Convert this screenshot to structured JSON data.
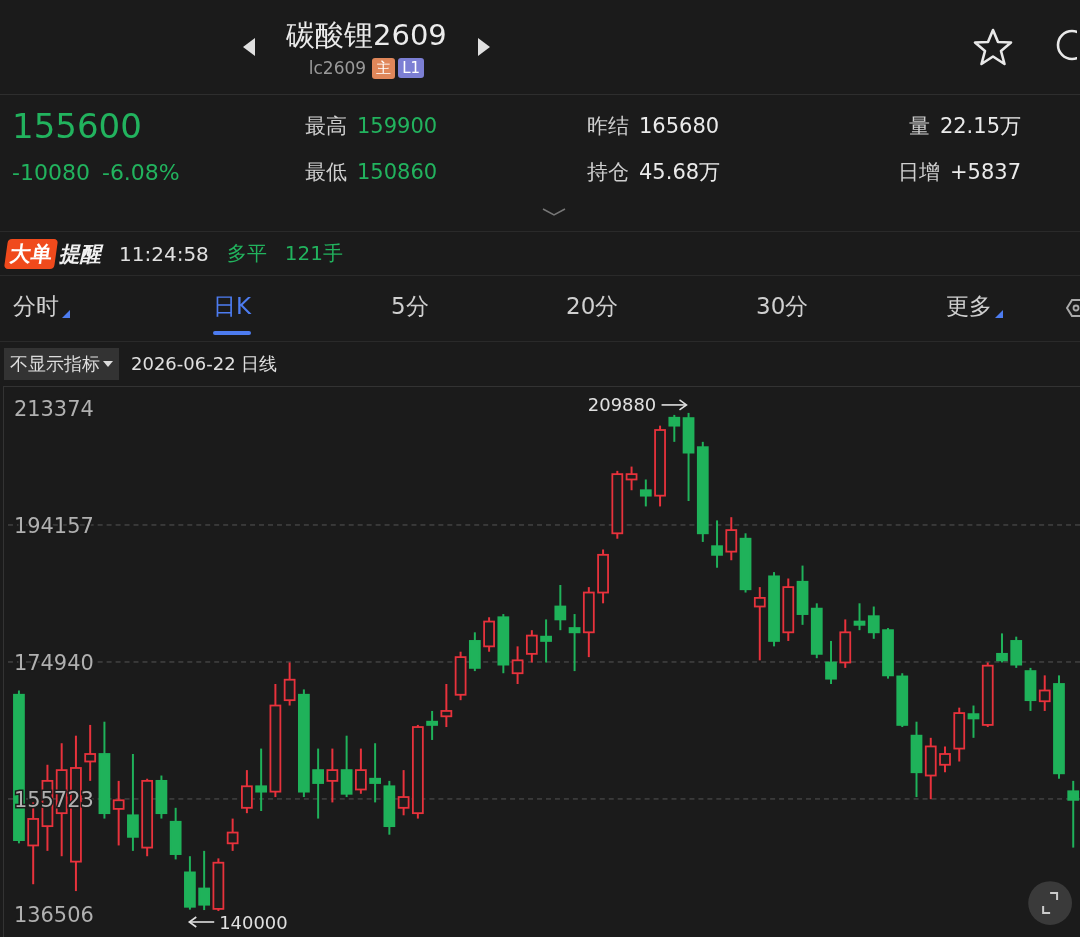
{
  "header": {
    "title": "碳酸锂2609",
    "code": "lc2609",
    "badges": [
      {
        "label": "主",
        "color": "#e0875a"
      },
      {
        "label": "L1",
        "color": "#7c7fd4"
      }
    ]
  },
  "quote": {
    "price": "155600",
    "change": "-10080",
    "change_pct": "-6.08%",
    "stats": [
      {
        "label": "最高",
        "value": "159900",
        "color": "#22b35e"
      },
      {
        "label": "昨结",
        "value": "165680",
        "color": "#eaeaea"
      },
      {
        "label": "量",
        "value": "22.15万",
        "color": "#eaeaea"
      },
      {
        "label": "最低",
        "value": "150860",
        "color": "#22b35e"
      },
      {
        "label": "持仓",
        "value": "45.68万",
        "color": "#eaeaea"
      },
      {
        "label": "日增",
        "value": "+5837",
        "color": "#eaeaea"
      }
    ]
  },
  "alert": {
    "logo_main": "大单",
    "logo_sub": "提醒",
    "time": "11:24:58",
    "action": "多平",
    "volume": "121手"
  },
  "tabs": [
    {
      "label": "分时",
      "selected": false,
      "has_menu": true
    },
    {
      "label": "日K",
      "selected": true,
      "has_menu": false
    },
    {
      "label": "5分",
      "selected": false,
      "has_menu": false
    },
    {
      "label": "20分",
      "selected": false,
      "has_menu": false
    },
    {
      "label": "30分",
      "selected": false,
      "has_menu": false
    },
    {
      "label": "更多",
      "selected": false,
      "has_menu": true
    }
  ],
  "indicator": {
    "dropdown": "不显示指标",
    "date_label": "2026-06-22 日线"
  },
  "chart": {
    "y_labels": [
      "213374",
      "194157",
      "174940",
      "155723",
      "136506"
    ],
    "high_marker": "209880",
    "low_marker": "140000",
    "chart_data": {
      "type": "candlestick",
      "grid": true,
      "ylim": [
        136506,
        213374
      ],
      "yticks": [
        213374,
        194157,
        174940,
        155723,
        136506
      ],
      "ohlc": [
        [
          170340,
          170940,
          149500,
          149950
        ],
        [
          149200,
          155240,
          143760,
          152920
        ],
        [
          151910,
          160520,
          148440,
          158260
        ],
        [
          153730,
          163540,
          147690,
          159770
        ],
        [
          146930,
          164600,
          142800,
          160070
        ],
        [
          160980,
          166110,
          158260,
          162030
        ],
        [
          162030,
          166560,
          152970,
          153730
        ],
        [
          154330,
          158260,
          149200,
          155540
        ],
        [
          153430,
          162030,
          148440,
          150410
        ],
        [
          148900,
          158560,
          147690,
          158260
        ],
        [
          158260,
          159010,
          152970,
          153730
        ],
        [
          152520,
          154480,
          147240,
          147990
        ],
        [
          145420,
          147690,
          140200,
          140600
        ],
        [
          143160,
          148440,
          140140,
          140890
        ],
        [
          140300,
          147390,
          140000,
          146780
        ],
        [
          149500,
          152970,
          148440,
          151010
        ],
        [
          154480,
          159770,
          153730,
          157500
        ],
        [
          157500,
          162790,
          154030,
          156750
        ],
        [
          156750,
          171850,
          155990,
          168830
        ],
        [
          169580,
          174870,
          168830,
          172450
        ],
        [
          170340,
          171090,
          155990,
          156750
        ],
        [
          159770,
          162790,
          152970,
          157960
        ],
        [
          158260,
          162790,
          155240,
          159770
        ],
        [
          159770,
          164600,
          155990,
          156450
        ],
        [
          157050,
          162790,
          156450,
          159770
        ],
        [
          158560,
          163540,
          155240,
          157960
        ],
        [
          157500,
          158260,
          150710,
          151910
        ],
        [
          154480,
          159770,
          153430,
          155990
        ],
        [
          153730,
          166110,
          152970,
          165810
        ],
        [
          166560,
          168070,
          164000,
          166110
        ],
        [
          167320,
          171850,
          165810,
          168070
        ],
        [
          170340,
          176380,
          169580,
          175620
        ],
        [
          177890,
          179100,
          173660,
          174110
        ],
        [
          177130,
          181210,
          176380,
          180610
        ],
        [
          181210,
          181660,
          173360,
          174570
        ],
        [
          173360,
          177130,
          171850,
          175170
        ],
        [
          176080,
          179400,
          174870,
          178640
        ],
        [
          178490,
          180910,
          174870,
          177890
        ],
        [
          182720,
          185740,
          179400,
          180910
        ],
        [
          179700,
          181660,
          173660,
          179100
        ],
        [
          179100,
          185440,
          175620,
          184680
        ],
        [
          184680,
          190720,
          183170,
          189970
        ],
        [
          192990,
          201750,
          192230,
          201290
        ],
        [
          200540,
          202350,
          199030,
          201290
        ],
        [
          199030,
          200540,
          196760,
          198270
        ],
        [
          198270,
          208090,
          196760,
          207480
        ],
        [
          209200,
          209600,
          205820,
          208090
        ],
        [
          209150,
          209880,
          197520,
          204310
        ],
        [
          205070,
          205820,
          191780,
          192990
        ],
        [
          191180,
          194800,
          188160,
          189970
        ],
        [
          190420,
          195250,
          189210,
          193440
        ],
        [
          192230,
          192990,
          184680,
          185140
        ],
        [
          182720,
          185440,
          175170,
          183930
        ],
        [
          186950,
          187550,
          177130,
          177890
        ],
        [
          179100,
          186650,
          177890,
          185440
        ],
        [
          186190,
          188460,
          180150,
          181660
        ],
        [
          182420,
          183170,
          175470,
          176080
        ],
        [
          174870,
          177890,
          171850,
          172600
        ],
        [
          174870,
          180910,
          174110,
          179100
        ],
        [
          180610,
          183170,
          179400,
          180150
        ],
        [
          181360,
          182720,
          178190,
          179100
        ],
        [
          179400,
          179700,
          172600,
          173060
        ],
        [
          172910,
          173360,
          165810,
          166110
        ],
        [
          164600,
          166560,
          155990,
          159470
        ],
        [
          159010,
          164300,
          155690,
          163090
        ],
        [
          160520,
          163090,
          159470,
          162030
        ],
        [
          162790,
          168530,
          160980,
          167770
        ],
        [
          167620,
          168830,
          164300,
          167020
        ],
        [
          166110,
          174870,
          165810,
          174420
        ],
        [
          176080,
          178950,
          174870,
          175170
        ],
        [
          177890,
          178490,
          174110,
          174570
        ],
        [
          173660,
          174110,
          168070,
          169580
        ],
        [
          169430,
          173060,
          168070,
          170940
        ],
        [
          171850,
          173060,
          158560,
          159320
        ],
        [
          156800,
          158260,
          148900,
          155600
        ]
      ]
    }
  }
}
